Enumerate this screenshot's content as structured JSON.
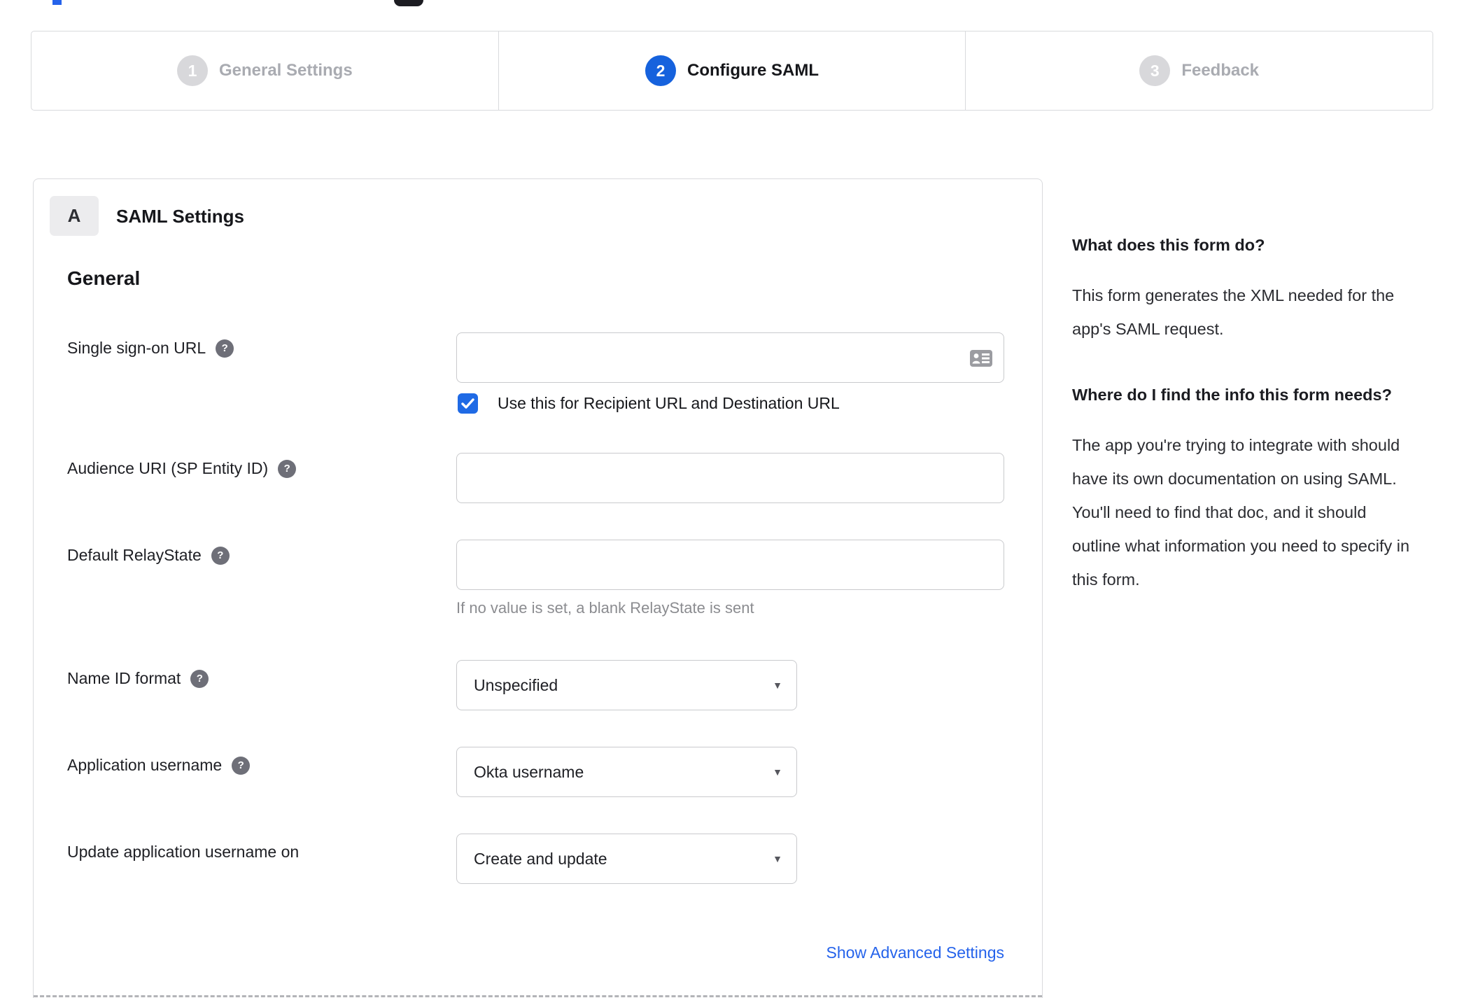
{
  "stepper": {
    "steps": [
      {
        "number": "1",
        "label": "General Settings",
        "state": "inactive"
      },
      {
        "number": "2",
        "label": "Configure SAML",
        "state": "active"
      },
      {
        "number": "3",
        "label": "Feedback",
        "state": "inactive"
      }
    ]
  },
  "panel": {
    "section_badge": "A",
    "section_title": "SAML Settings",
    "group_title": "General",
    "fields": {
      "sso": {
        "label": "Single sign-on URL",
        "value": "",
        "checkbox_label": "Use this for Recipient URL and Destination URL",
        "checked": true
      },
      "audience": {
        "label": "Audience URI (SP Entity ID)",
        "value": ""
      },
      "relay": {
        "label": "Default RelayState",
        "value": "",
        "hint": "If no value is set, a blank RelayState is sent"
      },
      "nameid": {
        "label": "Name ID format",
        "value": "Unspecified"
      },
      "appuser": {
        "label": "Application username",
        "value": "Okta username"
      },
      "updateuser": {
        "label": "Update application username on",
        "value": "Create and update"
      }
    },
    "advanced_link": "Show Advanced Settings",
    "help_glyph": "?"
  },
  "help": {
    "sections": [
      {
        "heading": "What does this form do?",
        "body": "This form generates the XML needed for the app's SAML request."
      },
      {
        "heading": "Where do I find the info this form needs?",
        "body": "The app you're trying to integrate with should have its own documentation on using SAML. You'll need to find that doc, and it should outline what information you need to specify in this form."
      }
    ]
  },
  "colors": {
    "accent_blue": "#1662dd",
    "checkbox_blue": "#1f6ae5",
    "link_blue": "#2563eb",
    "border_gray": "#d9dadd",
    "inactive_gray": "#d8d8db"
  }
}
